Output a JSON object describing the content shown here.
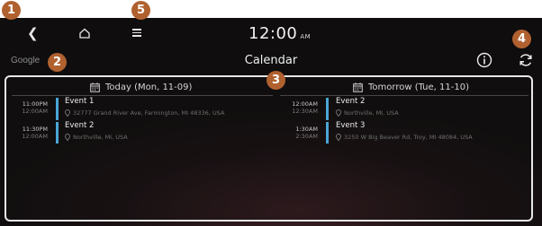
{
  "header": {
    "time": "12:00",
    "ampm": "AM",
    "source": "Google",
    "title": "Calendar"
  },
  "icons": [
    "back-icon",
    "home-icon",
    "menu-icon",
    "info-icon",
    "refresh-icon",
    "calendar-icon",
    "location-pin-icon"
  ],
  "callouts": [
    "1",
    "2",
    "3",
    "4",
    "5"
  ],
  "colors": {
    "badge": "#b0612f",
    "event_bar": "#4aa5d6",
    "background": "#1a1113"
  },
  "today": {
    "label": "Today (Mon, 11-09)",
    "events": [
      {
        "start": "11:00PM",
        "end": "12:00AM",
        "title": "Event 1",
        "location": "32777 Grand River Ave, Farmington, MI 48336, USA"
      },
      {
        "start": "11:30PM",
        "end": "12:00AM",
        "title": "Event 2",
        "location": "Northville, MI, USA"
      }
    ]
  },
  "tomorrow": {
    "label": "Tomorrow (Tue, 11-10)",
    "events": [
      {
        "start": "12:00AM",
        "end": "12:30AM",
        "title": "Event 2",
        "location": "Northville, MI, USA"
      },
      {
        "start": "1:30AM",
        "end": "2:30AM",
        "title": "Event 3",
        "location": "3250 W Big Beaver Rd, Troy, MI 48084, USA"
      }
    ]
  }
}
